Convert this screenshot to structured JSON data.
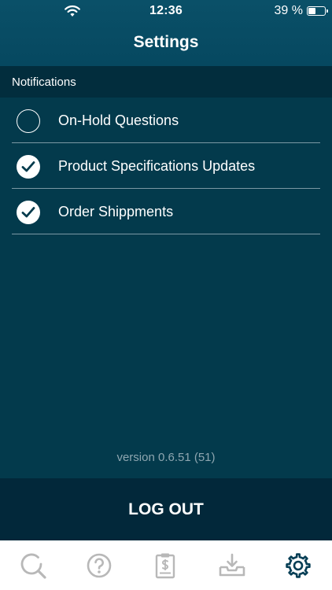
{
  "status_bar": {
    "time": "12:36",
    "battery_text": "39 %",
    "battery_level": 0.39,
    "icons": [
      "wifi-icon",
      "battery-icon"
    ]
  },
  "header": {
    "title": "Settings"
  },
  "notifications": {
    "section_label": "Notifications",
    "items": [
      {
        "label": "On-Hold Questions",
        "checked": false
      },
      {
        "label": "Product Specifications Updates",
        "checked": true
      },
      {
        "label": "Order Shippments",
        "checked": true
      }
    ]
  },
  "footer": {
    "version": "version 0.6.51 (51)",
    "logout_label": "LOG OUT"
  },
  "tab_bar": {
    "tabs": [
      {
        "icon": "search-icon",
        "active": false
      },
      {
        "icon": "help-icon",
        "active": false
      },
      {
        "icon": "invoice-icon",
        "active": false
      },
      {
        "icon": "inbox-download-icon",
        "active": false
      },
      {
        "icon": "gear-icon",
        "active": true
      }
    ]
  },
  "colors": {
    "background": "#033a4c",
    "header": "#0a5068",
    "section_header": "#022d3d",
    "logout_background": "#02283a",
    "tab_icon_inactive": "#b8b8b8",
    "tab_icon_active": "#063e55"
  }
}
